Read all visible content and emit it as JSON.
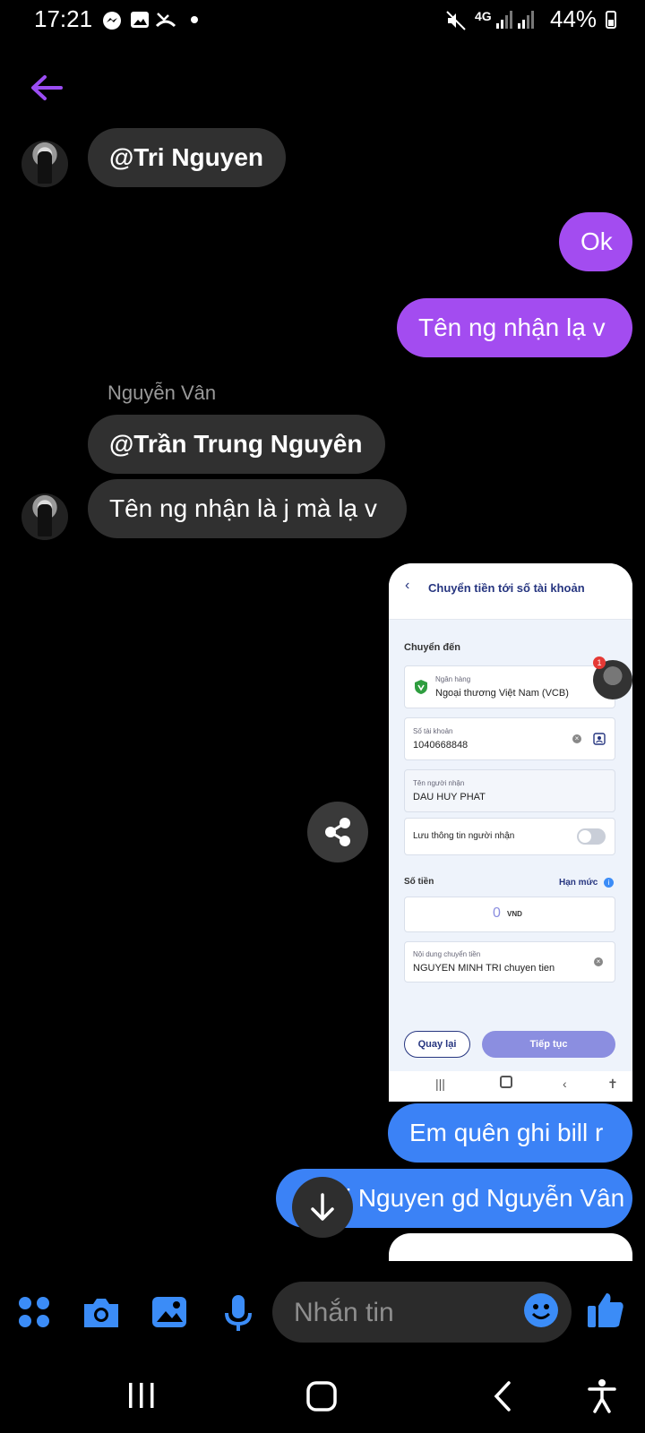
{
  "status_bar": {
    "time": "17:21",
    "network": "4G",
    "battery": "44%"
  },
  "messages": {
    "mention_tri": "@Tri Nguyen",
    "me_ok": "Ok",
    "me_ten": "Tên ng nhận lạ v",
    "sender_name": "Nguyễn Vân",
    "mention_tran": "@Trần Trung Nguyên",
    "in_question": "Tên ng nhận là j mà lạ v",
    "me_quen": "Em quên ghi bill r",
    "me_gd": "@Tri Nguyen gd Nguyễn Vân"
  },
  "shared_image": {
    "header_title": "Chuyển tiền tới số tài khoản",
    "section_to": "Chuyển đến",
    "bank_caption": "Ngân hàng",
    "bank_value": "Ngoại thương Việt Nam (VCB)",
    "account_caption": "Số tài khoản",
    "account_value": "1040668848",
    "recipient_caption": "Tên người nhận",
    "recipient_value": "DAU HUY PHAT",
    "save_recipient": "Lưu thông tin người nhận",
    "amount_label": "Số tiền",
    "limit_label": "Hạn mức",
    "amount_value": "0",
    "currency": "VND",
    "note_caption": "Nội dung chuyển tiền",
    "note_value": "NGUYEN MINH TRI chuyen tien",
    "back_button": "Quay lại",
    "continue_button": "Tiếp tục",
    "badge_count": "1"
  },
  "composer": {
    "placeholder": "Nhắn tin"
  },
  "colors": {
    "accent_purple": "#a34cf0",
    "accent_blue": "#3b82f6",
    "icon_blue": "#3b8cf7"
  }
}
